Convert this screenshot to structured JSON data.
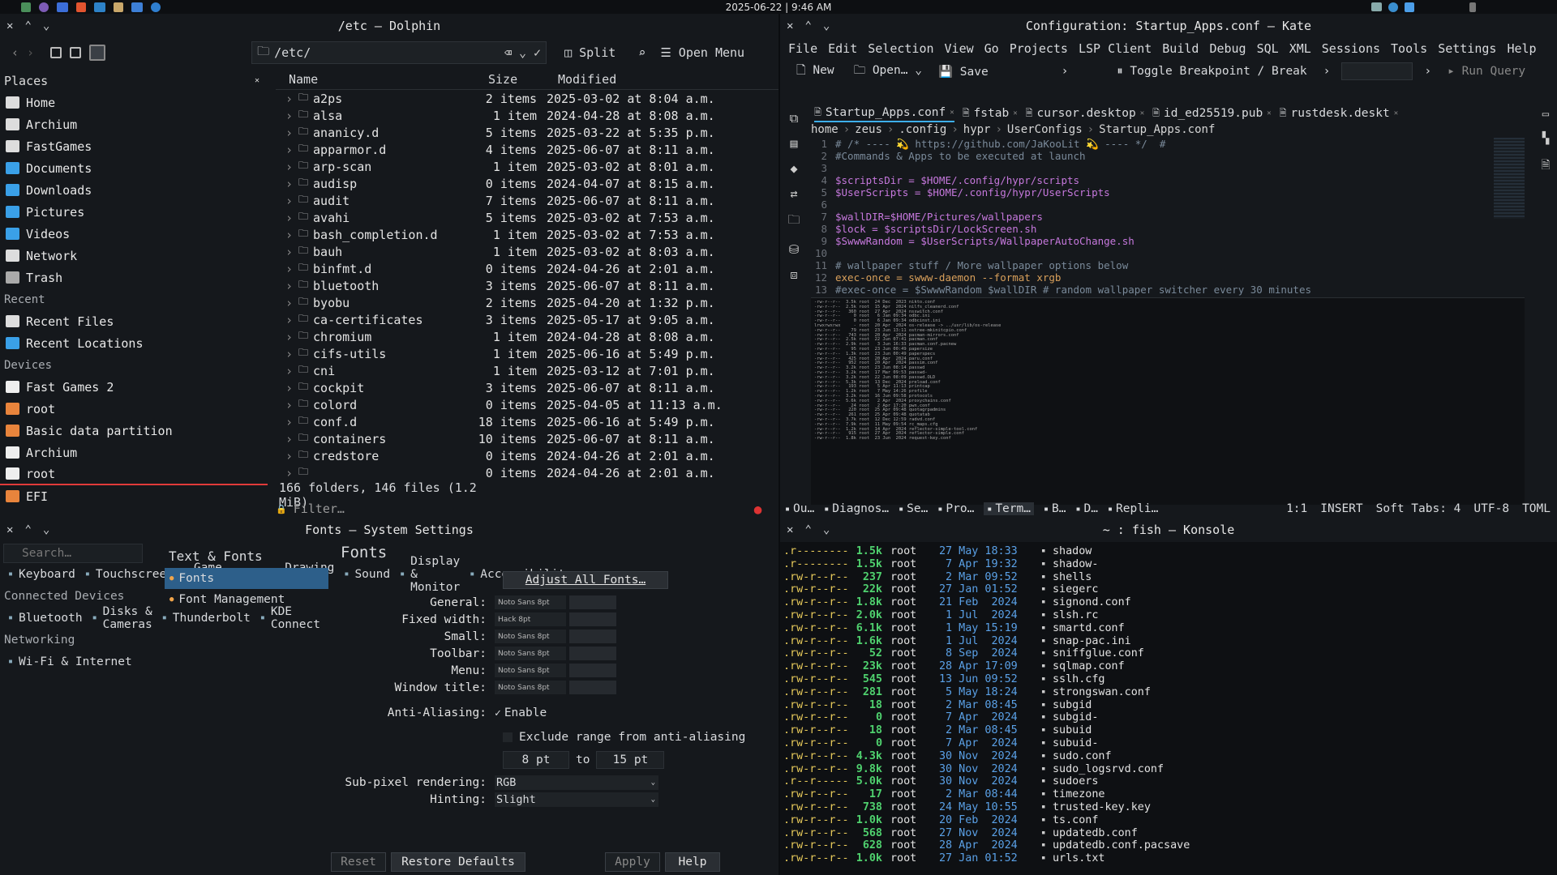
{
  "topbar": {
    "clock": "2025-06-22 | 9:46 AM"
  },
  "dolphin": {
    "title": "/etc — Dolphin",
    "toolbar": {
      "path": "/etc/",
      "split": "Split",
      "open_menu": "Open Menu"
    },
    "places_header": "Places",
    "places": [
      "Home",
      "Archium",
      "FastGames",
      "Documents",
      "Downloads",
      "Pictures",
      "Videos",
      "Network",
      "Trash"
    ],
    "recent_header": "Recent",
    "recent": [
      "Recent Files",
      "Recent Locations"
    ],
    "devices_header": "Devices",
    "devices": [
      "Fast Games 2",
      "root",
      "Basic data partition",
      "Archium",
      "root",
      "EFI"
    ],
    "columns": {
      "name": "Name",
      "size": "Size",
      "modified": "Modified"
    },
    "rows": [
      {
        "name": "a2ps",
        "size": "2 items",
        "modified": "2025-03-02 at 8:04 a.m."
      },
      {
        "name": "alsa",
        "size": "1 item",
        "modified": "2024-04-28 at 8:08 a.m."
      },
      {
        "name": "ananicy.d",
        "size": "5 items",
        "modified": "2025-03-22 at 5:35 p.m."
      },
      {
        "name": "apparmor.d",
        "size": "4 items",
        "modified": "2025-06-07 at 8:11 a.m."
      },
      {
        "name": "arp-scan",
        "size": "1 item",
        "modified": "2025-03-02 at 8:01 a.m."
      },
      {
        "name": "audisp",
        "size": "0 items",
        "modified": "2024-04-07 at 8:15 a.m."
      },
      {
        "name": "audit",
        "size": "7 items",
        "modified": "2025-06-07 at 8:11 a.m."
      },
      {
        "name": "avahi",
        "size": "5 items",
        "modified": "2025-03-02 at 7:53 a.m."
      },
      {
        "name": "bash_completion.d",
        "size": "1 item",
        "modified": "2025-03-02 at 7:53 a.m."
      },
      {
        "name": "bauh",
        "size": "1 item",
        "modified": "2025-03-02 at 8:03 a.m."
      },
      {
        "name": "binfmt.d",
        "size": "0 items",
        "modified": "2024-04-26 at 2:01 a.m."
      },
      {
        "name": "bluetooth",
        "size": "3 items",
        "modified": "2025-06-07 at 8:11 a.m."
      },
      {
        "name": "byobu",
        "size": "2 items",
        "modified": "2025-04-20 at 1:32 p.m."
      },
      {
        "name": "ca-certificates",
        "size": "3 items",
        "modified": "2025-05-17 at 9:05 a.m."
      },
      {
        "name": "chromium",
        "size": "1 item",
        "modified": "2024-04-28 at 8:08 a.m."
      },
      {
        "name": "cifs-utils",
        "size": "1 item",
        "modified": "2025-06-16 at 5:49 p.m."
      },
      {
        "name": "cni",
        "size": "1 item",
        "modified": "2025-03-12 at 7:01 p.m."
      },
      {
        "name": "cockpit",
        "size": "3 items",
        "modified": "2025-06-07 at 8:11 a.m."
      },
      {
        "name": "colord",
        "size": "0 items",
        "modified": "2025-04-05 at 11:13 a.m."
      },
      {
        "name": "conf.d",
        "size": "18 items",
        "modified": "2025-06-16 at 5:49 p.m."
      },
      {
        "name": "containers",
        "size": "10 items",
        "modified": "2025-06-07 at 8:11 a.m."
      },
      {
        "name": "credstore",
        "size": "0 items",
        "modified": "2024-04-26 at 2:01 a.m."
      },
      {
        "name": "",
        "size": "0 items",
        "modified": "2024-04-26 at 2:01 a.m."
      }
    ],
    "status": "166 folders, 146 files (1.2 MiB)",
    "filter_placeholder": "Filter…"
  },
  "kate": {
    "title": "Configuration: Startup_Apps.conf — Kate",
    "menu": [
      "File",
      "Edit",
      "Selection",
      "View",
      "Go",
      "Projects",
      "LSP Client",
      "Build",
      "Debug",
      "SQL",
      "XML",
      "Sessions",
      "Tools",
      "Settings",
      "Help"
    ],
    "toolbar": {
      "new": "New",
      "open": "Open…",
      "save": "Save",
      "toggle": "Toggle Breakpoint / Break",
      "run": "Run Query"
    },
    "tabs": [
      "Startup_Apps.conf",
      "fstab",
      "cursor.desktop",
      "id_ed25519.pub",
      "rustdesk.deskt"
    ],
    "breadcrumb": [
      "home",
      "zeus",
      ".config",
      "hypr",
      "UserConfigs",
      "Startup_Apps.conf"
    ],
    "code": [
      "# /* ---- 💫 https://github.com/JaKooLit 💫 ---- */  #",
      "#Commands & Apps to be executed at launch",
      "",
      "$scriptsDir = $HOME/.config/hypr/scripts",
      "$UserScripts = $HOME/.config/hypr/UserScripts",
      "",
      "$wallDIR=$HOME/Pictures/wallpapers",
      "$lock = $scriptsDir/LockScreen.sh",
      "$SwwwRandom = $UserScripts/WallpaperAutoChange.sh",
      "",
      "# wallpaper stuff / More wallpaper options below",
      "exec-once = swww-daemon --format xrgb",
      "#exec-once = $SwwwRandom $wallDIR # random wallpaper switcher every 30 minutes"
    ],
    "bottom_tabs": [
      "Ou…",
      "Diagnos…",
      "Se…",
      "Pro…",
      "Term…",
      "B…",
      "D…",
      "Repli…"
    ],
    "status": {
      "pos": "1:1",
      "mode": "INSERT",
      "tabs": "Soft Tabs: 4",
      "enc": "UTF-8",
      "syntax": "TOML"
    },
    "mini_terminal": [
      "-rw-r--r--  3.5k root  24 Dec  2023 nikto.conf",
      "-rw-r--r--  2.5k root  15 Apr  2024 nilfs_cleanerd.conf",
      "-rw-r--r--   360 root  27 Apr  2024 nsswitch.conf",
      "-rw-r--r--     0 root   6 Jan 09:34 odbc.ini",
      "-rw-r--r--     0 root   6 Jan 09:34 odbcinst.ini",
      "lrwxrwxrwx     - root  20 Apr  2024 os-release -> ../usr/lib/os-release",
      "-rw-r--r--    79 root  23 Jun 13:11 ostree-mkinitcpio.conf",
      "-rw-r--r--   743 root  20 Apr  2024 pacman-mirrors.conf",
      "-rw-r--r--  2.5k root  22 Jun 07:41 pacman.conf",
      "-rw-r--r--  2.9k root   3 Jun 16:33 pacman.conf.pacnew",
      "-rw-r--r--    95 root  23 Jun 00:49 papersize",
      "-rw-r--r--  1.3k root  23 Jun 00:49 paperspecs",
      "-rw-r--r--   425 root  20 Apr  2024 paru.conf",
      "-rw-r--r--   952 root  20 Apr  2024 passim.conf",
      "-rw-r--r--  3.2k root  23 Jun 08:14 passwd",
      "-rw-r--r--  3.2k root  17 Mar 09:53 passwd-",
      "-rw-r--r--  3.2k root  22 Jun 08:09 passwd.OLD",
      "-rw-r--r--  5.3k root  13 Dec  2024 preload.conf",
      "-rw-r--r--   193 root   5 Apr 11:13 printcap",
      "-rw-r--r--  1.2k root   7 May 14:26 profile",
      "-rw-r--r--  3.2k root  16 Jun 09:58 protocols",
      "-rw-r--r--  5.6k root   2 Apr  2024 proxychains.conf",
      "-rw-r--r--    24 root   2 Apr 17:20 pwn.conf",
      "-rw-r--r--   220 root  25 Apr 09:48 quotagrpadmins",
      "-rw-r--r--   261 root  25 Apr 09:48 quotatab",
      "-rw-r--r--  3.7k root  12 Dec 12:59 radvd.conf",
      "-rw-r--r--  7.9k root  11 May 09:54 rc_maps.cfg",
      "-rw-r--r--  1.2k root  14 Apr  2024 reflector-simple-tool.conf",
      "-rw-r--r--   915 root  27 Apr  2024 reflector-simple.conf",
      "-rw-r--r--  1.8k root  23 Jun  2024 request-key.conf"
    ]
  },
  "settings": {
    "title": "Fonts — System Settings",
    "search_placeholder": "Search…",
    "left_items": [
      "Keyboard",
      "Touchscreen",
      "Game Controller",
      "Drawing Tablet",
      "Sound",
      "Display & Monitor",
      "Accessibility"
    ],
    "connected_header": "Connected Devices",
    "connected_items": [
      "Bluetooth",
      "Disks & Cameras",
      "Thunderbolt",
      "KDE Connect"
    ],
    "networking_header": "Networking",
    "networking_items": [
      "Wi-Fi & Internet"
    ],
    "middle_header": "Text & Fonts",
    "middle_items": [
      "Fonts",
      "Font Management"
    ],
    "page_title": "Fonts",
    "adjust_all": "Adjust All Fonts…",
    "font_rows": [
      {
        "label": "General:",
        "value": "Noto Sans 8pt"
      },
      {
        "label": "Fixed width:",
        "value": "Hack 8pt"
      },
      {
        "label": "Small:",
        "value": "Noto Sans 8pt"
      },
      {
        "label": "Toolbar:",
        "value": "Noto Sans 8pt"
      },
      {
        "label": "Menu:",
        "value": "Noto Sans 8pt"
      },
      {
        "label": "Window title:",
        "value": "Noto Sans 8pt"
      }
    ],
    "aa_label": "Anti-Aliasing:",
    "aa_value": "Enable",
    "exclude": "Exclude range from anti-aliasing",
    "range_from": "8 pt",
    "range_to": "to",
    "range_to_val": "15 pt",
    "subpixel_label": "Sub-pixel rendering:",
    "subpixel_value": "RGB",
    "hinting_label": "Hinting:",
    "hinting_value": "Slight",
    "buttons": {
      "reset": "Reset",
      "restore": "Restore Defaults",
      "apply": "Apply",
      "help": "Help"
    }
  },
  "konsole": {
    "title": "~ : fish — Konsole",
    "lines": [
      {
        "perm": ".r--------",
        "size": "1.5k",
        "user": "root",
        "date": "27 May 18:33",
        "name": "shadow"
      },
      {
        "perm": ".r--------",
        "size": "1.5k",
        "user": "root",
        "date": " 7 Apr 19:32",
        "name": "shadow-"
      },
      {
        "perm": ".rw-r--r--",
        "size": "237",
        "user": "root",
        "date": " 2 Mar 09:52",
        "name": "shells"
      },
      {
        "perm": ".rw-r--r--",
        "size": "22k",
        "user": "root",
        "date": "27 Jan 01:52",
        "name": "siegerc"
      },
      {
        "perm": ".rw-r--r--",
        "size": "1.8k",
        "user": "root",
        "date": "21 Feb  2024",
        "name": "signond.conf"
      },
      {
        "perm": ".rw-r--r--",
        "size": "2.0k",
        "user": "root",
        "date": " 1 Jul  2024",
        "name": "slsh.rc"
      },
      {
        "perm": ".rw-r--r--",
        "size": "6.1k",
        "user": "root",
        "date": " 1 May 15:19",
        "name": "smartd.conf"
      },
      {
        "perm": ".rw-r--r--",
        "size": "1.6k",
        "user": "root",
        "date": " 1 Jul  2024",
        "name": "snap-pac.ini"
      },
      {
        "perm": ".rw-r--r--",
        "size": "52",
        "user": "root",
        "date": " 8 Sep  2024",
        "name": "sniffglue.conf"
      },
      {
        "perm": ".rw-r--r--",
        "size": "23k",
        "user": "root",
        "date": "28 Apr 17:09",
        "name": "sqlmap.conf"
      },
      {
        "perm": ".rw-r--r--",
        "size": "545",
        "user": "root",
        "date": "13 Jun 09:52",
        "name": "sslh.cfg"
      },
      {
        "perm": ".rw-r--r--",
        "size": "281",
        "user": "root",
        "date": " 5 May 18:24",
        "name": "strongswan.conf"
      },
      {
        "perm": ".rw-r--r--",
        "size": "18",
        "user": "root",
        "date": " 2 Mar 08:45",
        "name": "subgid"
      },
      {
        "perm": ".rw-r--r--",
        "size": "0",
        "user": "root",
        "date": " 7 Apr  2024",
        "name": "subgid-"
      },
      {
        "perm": ".rw-r--r--",
        "size": "18",
        "user": "root",
        "date": " 2 Mar 08:45",
        "name": "subuid"
      },
      {
        "perm": ".rw-r--r--",
        "size": "0",
        "user": "root",
        "date": " 7 Apr  2024",
        "name": "subuid-"
      },
      {
        "perm": ".rw-r--r--",
        "size": "4.3k",
        "user": "root",
        "date": "30 Nov  2024",
        "name": "sudo.conf"
      },
      {
        "perm": ".rw-r--r--",
        "size": "9.8k",
        "user": "root",
        "date": "30 Nov  2024",
        "name": "sudo_logsrvd.conf"
      },
      {
        "perm": ".r--r-----",
        "size": "5.0k",
        "user": "root",
        "date": "30 Nov  2024",
        "name": "sudoers"
      },
      {
        "perm": ".rw-r--r--",
        "size": "17",
        "user": "root",
        "date": " 2 Mar 08:44",
        "name": "timezone"
      },
      {
        "perm": ".rw-r--r--",
        "size": "738",
        "user": "root",
        "date": "24 May 10:55",
        "name": "trusted-key.key"
      },
      {
        "perm": ".rw-r--r--",
        "size": "1.0k",
        "user": "root",
        "date": "20 Feb  2024",
        "name": "ts.conf"
      },
      {
        "perm": ".rw-r--r--",
        "size": "568",
        "user": "root",
        "date": "27 Nov  2024",
        "name": "updatedb.conf"
      },
      {
        "perm": ".rw-r--r--",
        "size": "628",
        "user": "root",
        "date": "28 Apr  2024",
        "name": "updatedb.conf.pacsave"
      },
      {
        "perm": ".rw-r--r--",
        "size": "1.0k",
        "user": "root",
        "date": "27 Jan 01:52",
        "name": "urls.txt"
      }
    ]
  }
}
